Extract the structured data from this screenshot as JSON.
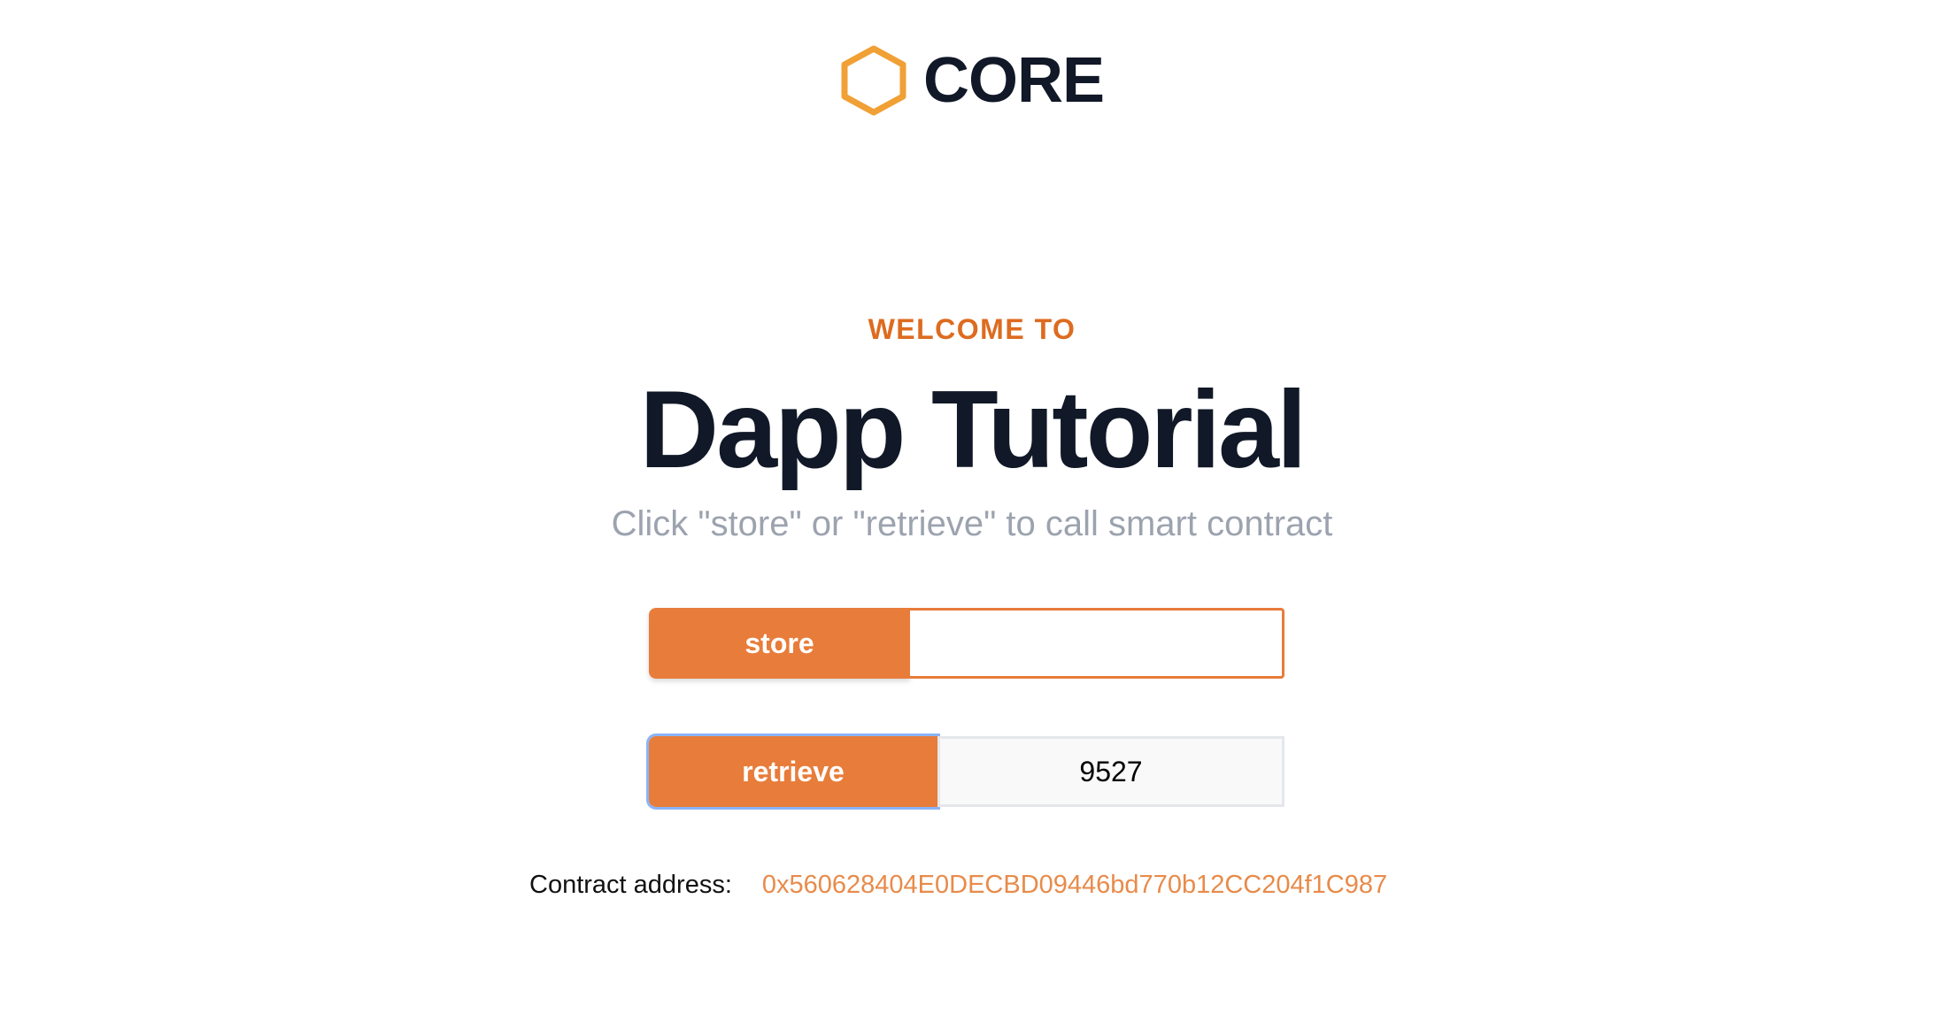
{
  "brand": {
    "name": "CORE",
    "icon": "hexagon-icon",
    "accent_color": "#F0A035"
  },
  "hero": {
    "eyebrow": "WELCOME TO",
    "title": "Dapp Tutorial",
    "subtitle": "Click \"store\" or \"retrieve\" to call smart contract"
  },
  "store": {
    "button_label": "store",
    "input_value": ""
  },
  "retrieve": {
    "button_label": "retrieve",
    "value": "9527"
  },
  "contract": {
    "label": "Contract address:",
    "address": "0x560628404E0DECBD09446bd770b12CC204f1C987"
  },
  "colors": {
    "primary": "#E87C3A",
    "heading": "#111827",
    "muted": "#9CA3AF",
    "focus": "#8AB4F8"
  }
}
